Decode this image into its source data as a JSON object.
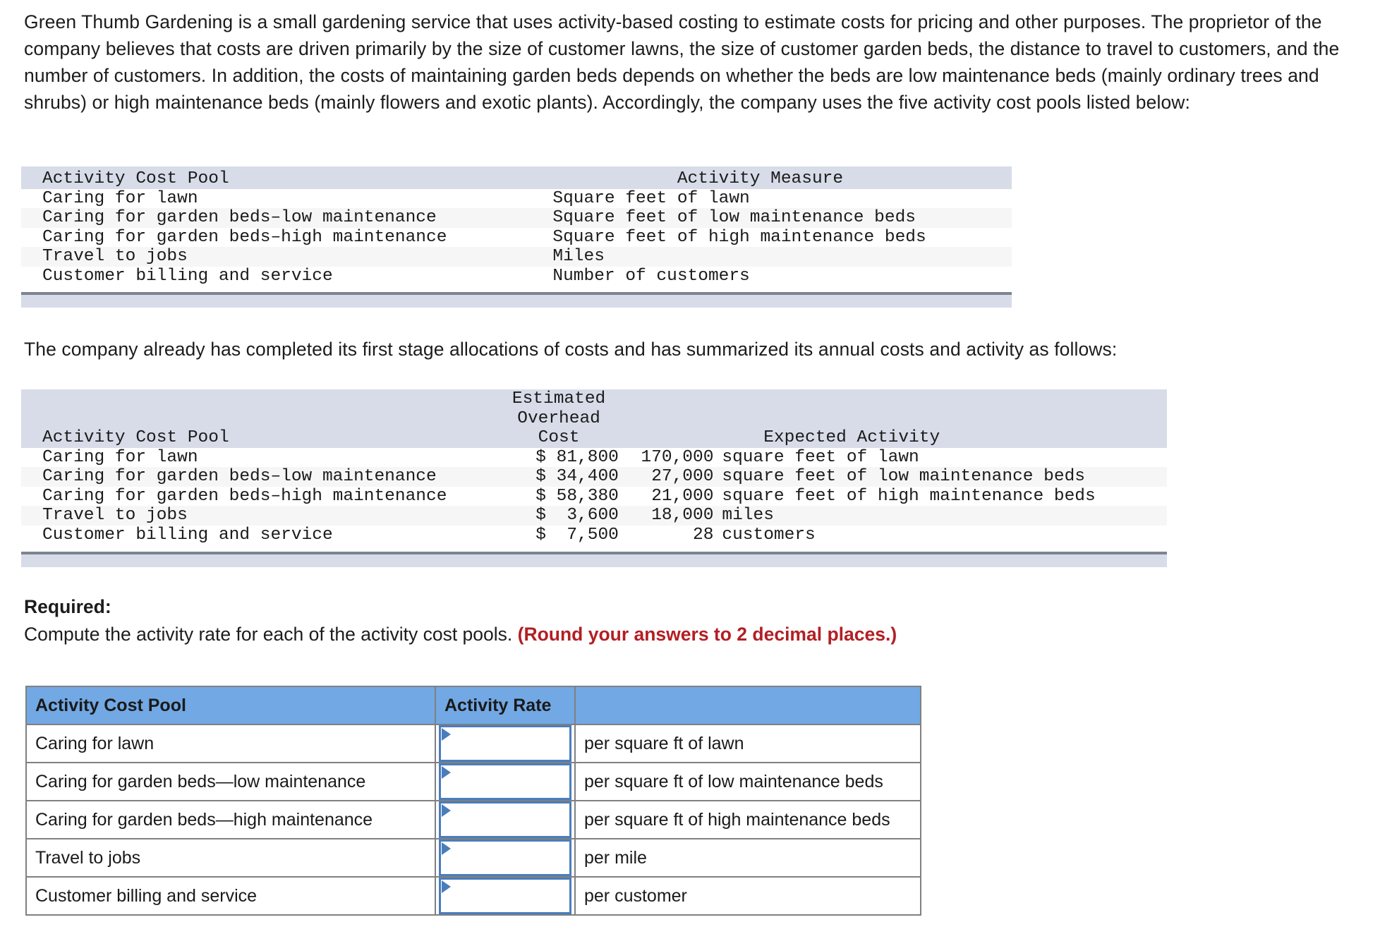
{
  "intro": {
    "paragraph": "Green Thumb Gardening is a small gardening service that uses activity-based costing to estimate costs for pricing and other purposes. The proprietor of the company believes that costs are driven primarily by the size of customer lawns, the size of customer garden beds, the distance to travel to customers, and the number of customers. In addition, the costs of maintaining garden beds depends on whether the beds are low maintenance beds (mainly ordinary trees and shrubs) or high maintenance beds (mainly flowers and exotic plants). Accordingly, the company uses the five activity cost pools listed below:"
  },
  "table_pools": {
    "headers": {
      "col1": "Activity Cost Pool",
      "col2": "            Activity Measure"
    },
    "rows": [
      {
        "pool": "Caring for lawn",
        "measure": "Square feet of lawn"
      },
      {
        "pool": "Caring for garden beds–low maintenance",
        "measure": "Square feet of low maintenance beds"
      },
      {
        "pool": "Caring for garden beds–high maintenance",
        "measure": "Square feet of high maintenance beds"
      },
      {
        "pool": "Travel to jobs",
        "measure": "Miles"
      },
      {
        "pool": "Customer billing and service",
        "measure": "Number of customers"
      }
    ]
  },
  "bridge_text": "The company already has completed its first stage allocations of costs and has summarized its annual costs and activity as follows:",
  "table_costs": {
    "headers": {
      "line1_cost": "Estimated",
      "line2_cost": "Overhead",
      "line3_cost": "Cost",
      "col1": "Activity Cost Pool",
      "col_activity": "    Expected Activity"
    },
    "rows": [
      {
        "pool": "Caring for lawn",
        "cost": "$ 81,800",
        "qty": "170,000",
        "unit": "square feet of lawn"
      },
      {
        "pool": "Caring for garden beds–low maintenance",
        "cost": "$ 34,400",
        "qty": "27,000",
        "unit": "square feet of low maintenance beds"
      },
      {
        "pool": "Caring for garden beds–high maintenance",
        "cost": "$ 58,380",
        "qty": "21,000",
        "unit": "square feet of high maintenance beds"
      },
      {
        "pool": "Travel to jobs",
        "cost": "$  3,600",
        "qty": "18,000",
        "unit": "miles"
      },
      {
        "pool": "Customer billing and service",
        "cost": "$  7,500",
        "qty": "28",
        "unit": "customers"
      }
    ]
  },
  "required": {
    "label": "Required:",
    "prompt": "Compute the activity rate for each of the activity cost pools. ",
    "rounding_note": "(Round your answers to 2 decimal places.)"
  },
  "answer_table": {
    "headers": {
      "pool": "Activity Cost Pool",
      "rate": "Activity Rate",
      "unit": ""
    },
    "rows": [
      {
        "pool": "Caring for lawn",
        "rate": "",
        "unit": "per square ft of lawn"
      },
      {
        "pool": "Caring for garden beds—low maintenance",
        "rate": "",
        "unit": "per square ft of low maintenance beds"
      },
      {
        "pool": "Caring for garden beds—high maintenance",
        "rate": "",
        "unit": "per square ft of high maintenance beds"
      },
      {
        "pool": "Travel to jobs",
        "rate": "",
        "unit": "per mile"
      },
      {
        "pool": "Customer billing and service",
        "rate": "",
        "unit": "per customer"
      }
    ]
  },
  "colors": {
    "header_blue": "#72a8e4",
    "table_header_bg": "#d7dce8",
    "zebra_bg": "#f6f6f6",
    "input_border": "#4a7ebb",
    "warning_red": "#b21f24",
    "table_border": "#808080"
  }
}
